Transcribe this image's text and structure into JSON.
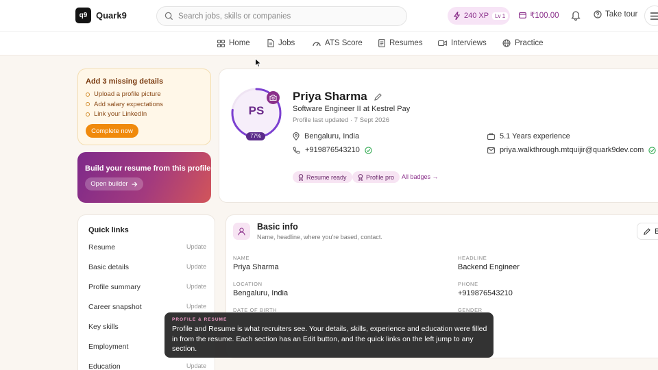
{
  "header": {
    "logo_mark": "q9",
    "brand": "Quark9",
    "search_placeholder": "Search jobs, skills or companies",
    "xp": "240 XP",
    "level": "Lv 1",
    "wallet": "₹100.00",
    "take_tour": "Take tour"
  },
  "nav": {
    "items": [
      {
        "label": "Home",
        "icon": "grid-icon"
      },
      {
        "label": "Jobs",
        "icon": "document-icon"
      },
      {
        "label": "ATS Score",
        "icon": "gauge-icon"
      },
      {
        "label": "Resumes",
        "icon": "resume-icon"
      },
      {
        "label": "Interviews",
        "icon": "video-icon"
      },
      {
        "label": "Practice",
        "icon": "globe-icon"
      }
    ]
  },
  "missing_card": {
    "title": "Add 3 missing details",
    "items": [
      "Upload a profile picture",
      "Add salary expectations",
      "Link your LinkedIn"
    ],
    "button": "Complete now"
  },
  "builder_card": {
    "title": "Build your resume from this profile",
    "button": "Open builder"
  },
  "profile": {
    "initials": "PS",
    "completion": "77%",
    "completion_value": 77,
    "name": "Priya Sharma",
    "role": "Software Engineer II at Kestrel Pay",
    "updated": "Profile last updated · 7 Sept 2026",
    "location": "Bengaluru, India",
    "phone": "+919876543210",
    "experience": "5.1 Years experience",
    "email": "priya.walkthrough.mtquijir@quark9dev.com",
    "badges": [
      "Resume ready",
      "Profile pro"
    ],
    "all_badges": "All badges →"
  },
  "quick_links": {
    "title": "Quick links",
    "update_label": "Update",
    "items": [
      "Resume",
      "Basic details",
      "Profile summary",
      "Career snapshot",
      "Key skills",
      "Employment",
      "Education"
    ]
  },
  "basic_info": {
    "title": "Basic info",
    "subtitle": "Name, headline, where you're based, contact.",
    "edit_label": "E",
    "fields": {
      "name_label": "NAME",
      "name_value": "Priya Sharma",
      "headline_label": "HEADLINE",
      "headline_value": "Backend Engineer",
      "location_label": "LOCATION",
      "location_value": "Bengaluru, India",
      "phone_label": "PHONE",
      "phone_value": "+919876543210",
      "dob_label": "DATE OF BIRTH",
      "gender_label": "GENDER"
    }
  },
  "tooltip": {
    "heading": "PROFILE & RESUME",
    "body": "Profile and Resume is what recruiters see. Your details, skills, experience and education were filled in from the resume. Each section has an Edit button, and the quick links on the left jump to any section."
  },
  "colors": {
    "accent": "#8a2f8a",
    "cta_orange": "#f08a0c",
    "verified_green": "#2fa84f",
    "page_bg": "#faf6f1"
  }
}
